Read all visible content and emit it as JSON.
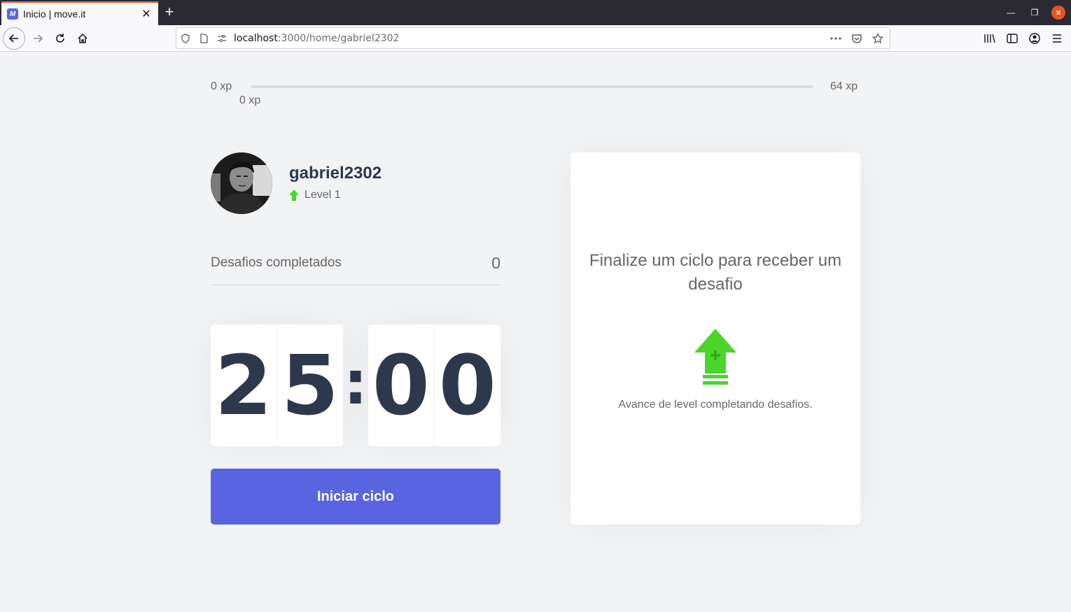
{
  "browser": {
    "tab_title": "Inicio | move.it",
    "favicon_text": "M",
    "url_host": "localhost",
    "url_path": ":3000/home/gabriel2302",
    "new_tab_symbol": "+",
    "icons": [
      "back-icon",
      "forward-icon",
      "reload-icon",
      "home-icon",
      "shield-icon",
      "page-icon",
      "more-icon",
      "pocket-icon",
      "star-icon",
      "library-icon",
      "sidebar-icon",
      "account-icon",
      "menu-icon"
    ]
  },
  "experience": {
    "min_label": "0 xp",
    "current_label": "0 xp",
    "max_label": "64 xp",
    "progress": 0
  },
  "profile": {
    "username": "gabriel2302",
    "level_label": "Level 1"
  },
  "stats": {
    "completed_label": "Desafios completados",
    "completed_count": "0"
  },
  "countdown": {
    "minute_left": "2",
    "minute_right": "5",
    "separator": ":",
    "second_left": "0",
    "second_right": "0"
  },
  "actions": {
    "start_label": "Iniciar ciclo"
  },
  "challenge": {
    "title": "Finalize um ciclo para receber um desafio",
    "text": "Avance de level completando desafios."
  },
  "colors": {
    "accent": "#5965e0",
    "green": "#4cd62b",
    "title": "#2e384d",
    "text": "#666666",
    "background": "#f2f3f5"
  }
}
